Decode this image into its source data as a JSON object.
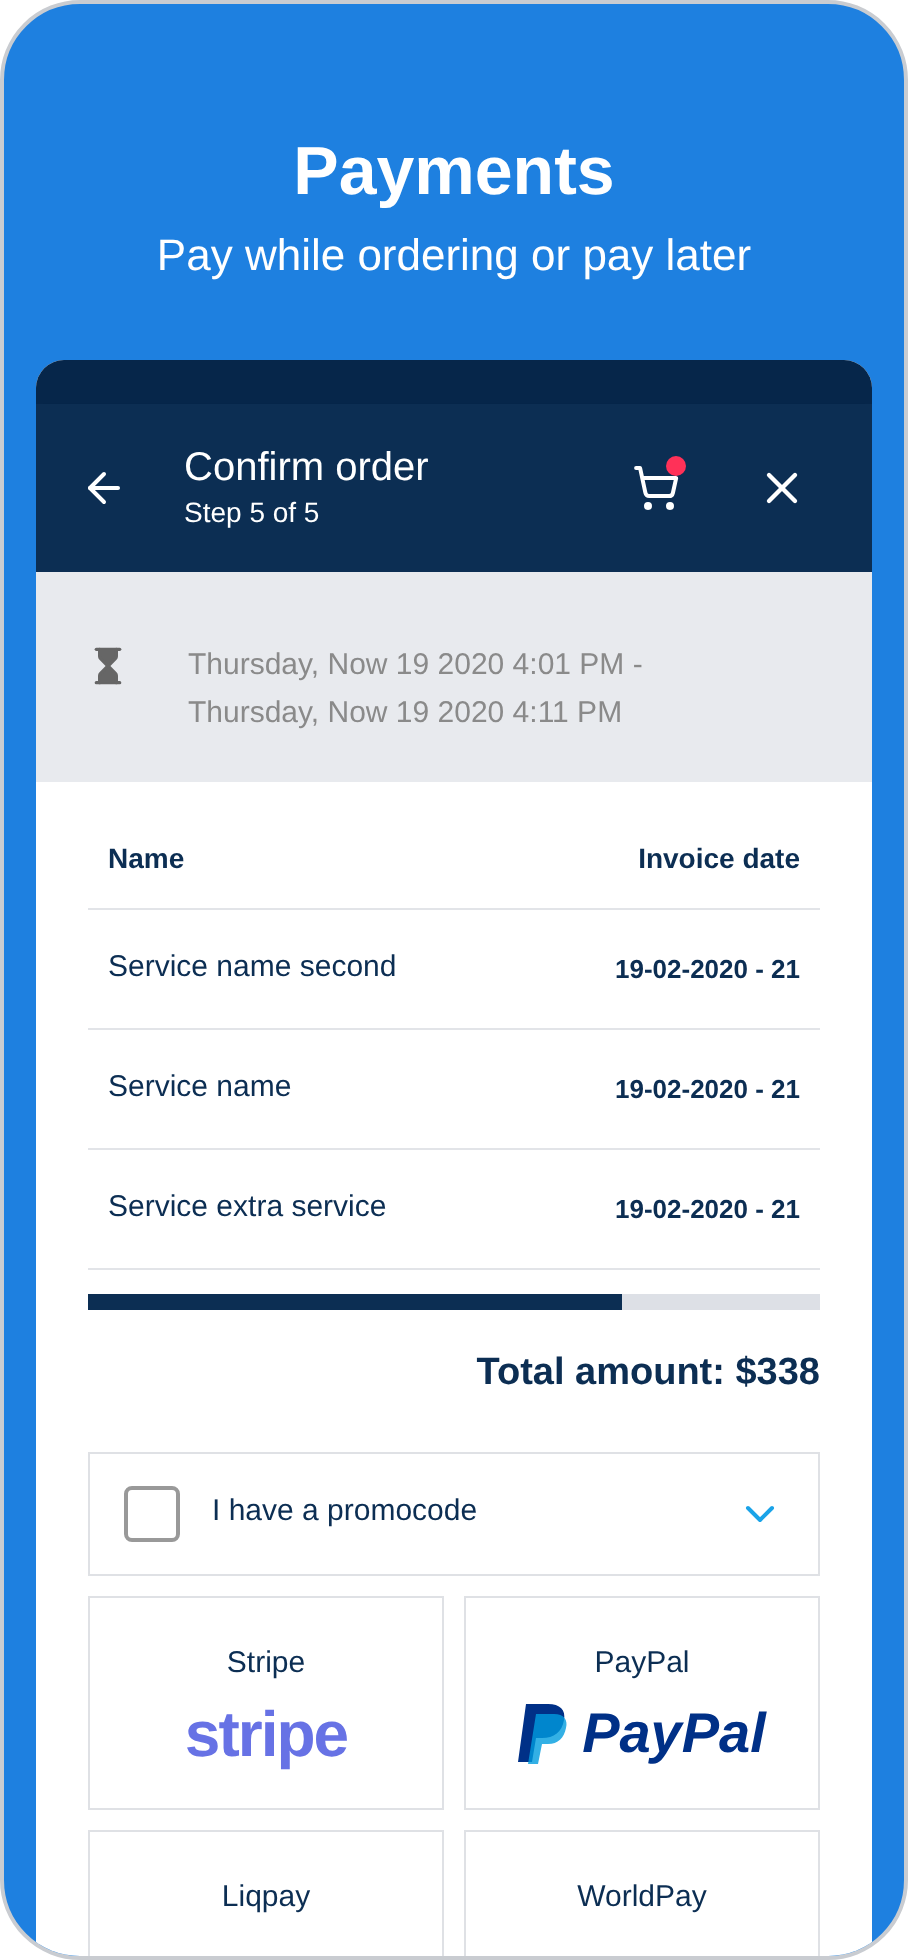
{
  "hero": {
    "title": "Payments",
    "subtitle": "Pay while ordering or pay later"
  },
  "app_bar": {
    "title": "Confirm order",
    "subtitle": "Step 5 of 5",
    "cart_badge": true
  },
  "time_range": {
    "lines": [
      "Thursday, Now 19 2020 4:01 PM -",
      "Thursday, Now 19 2020 4:11 PM"
    ]
  },
  "table": {
    "columns": [
      "Name",
      "Invoice date"
    ],
    "rows": [
      {
        "name": "Service name second",
        "date": "19-02-2020 - 21"
      },
      {
        "name": "Service name",
        "date": "19-02-2020 - 21"
      },
      {
        "name": "Service extra service",
        "date": "19-02-2020 - 21"
      }
    ]
  },
  "progress": {
    "level": 0.73
  },
  "total": "Total amount: $338",
  "promocode": {
    "label": "I have a promocode",
    "checked": false
  },
  "payment_methods": [
    {
      "name": "Stripe",
      "kind": "stripe",
      "logo": "stripe"
    },
    {
      "name": "PayPal",
      "kind": "paypal",
      "logo": "PayPal"
    },
    {
      "name": "Liqpay",
      "kind": "plain"
    },
    {
      "name": "WorldPay",
      "kind": "plain"
    }
  ]
}
